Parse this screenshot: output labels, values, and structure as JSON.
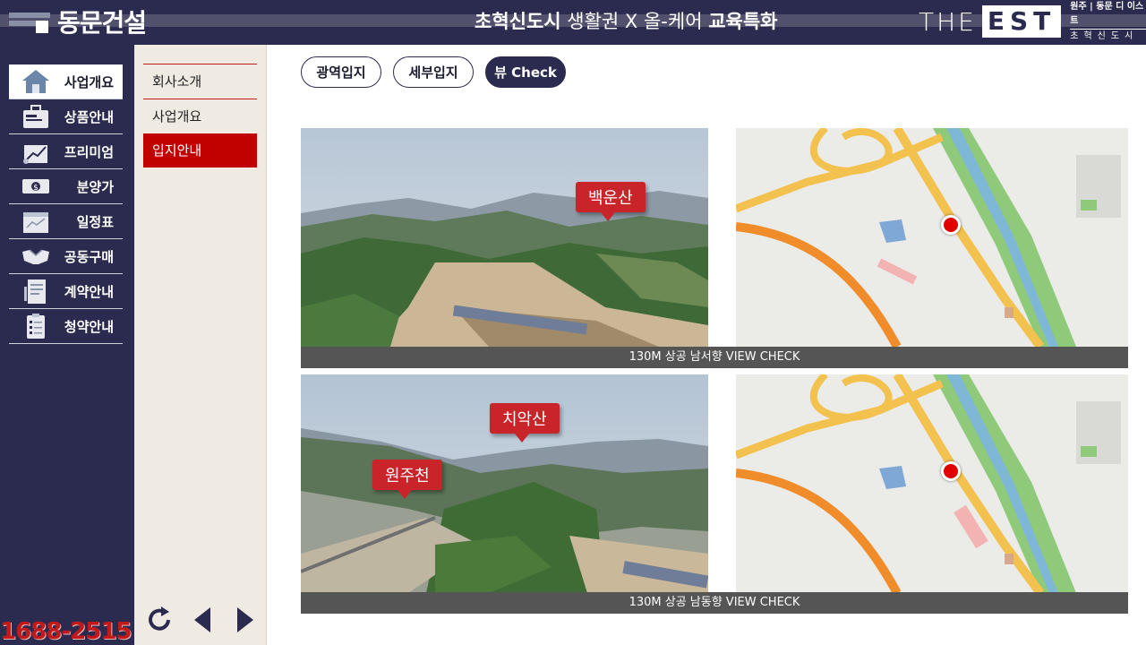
{
  "header": {
    "logo_text": "동문건설",
    "slogan_bold1": "초혁신도시",
    "slogan_mid": " 생활권 X 올-케어 ",
    "slogan_bold2": "교육특화",
    "brand_the": "THE",
    "brand_est": "EST",
    "brand_sub1": "원주 | 동문 디 이스트",
    "brand_sub2": "초혁신도시"
  },
  "sidebar": {
    "items": [
      {
        "label": "사업개요",
        "icon": "house-icon"
      },
      {
        "label": "상품안내",
        "icon": "briefcase-icon"
      },
      {
        "label": "프리미엄",
        "icon": "growth-chart-icon"
      },
      {
        "label": "분양가",
        "icon": "money-icon"
      },
      {
        "label": "일정표",
        "icon": "calendar-icon"
      },
      {
        "label": "공동구매",
        "icon": "handshake-icon"
      },
      {
        "label": "계약안내",
        "icon": "contract-icon"
      },
      {
        "label": "청약안내",
        "icon": "clipboard-icon"
      }
    ],
    "phone": "1688-2515"
  },
  "submenu": {
    "items": [
      {
        "label": "회사소개"
      },
      {
        "label": "사업개요"
      },
      {
        "label": "입지안내"
      }
    ]
  },
  "tabs": [
    {
      "label": "광역입지"
    },
    {
      "label": "세부입지"
    },
    {
      "label": "뷰 Check"
    }
  ],
  "views": [
    {
      "caption": "130M 상공 남서향 VIEW CHECK",
      "callouts": [
        "백운산"
      ]
    },
    {
      "caption": "130M 상공 남동향 VIEW CHECK",
      "callouts": [
        "치악산",
        "원주천"
      ]
    }
  ],
  "colors": {
    "navy": "#2b2b4f",
    "accent_red": "#c10000",
    "cream": "#efebe3"
  }
}
